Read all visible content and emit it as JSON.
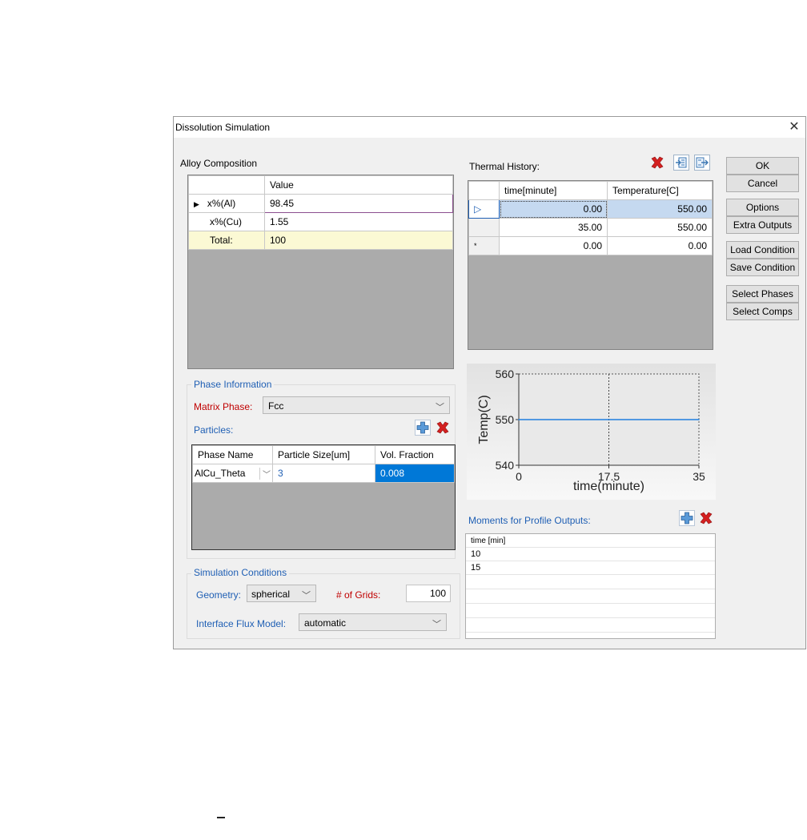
{
  "window": {
    "title": "Dissolution Simulation",
    "close_glyph": "✕"
  },
  "alloy": {
    "label": "Alloy Composition",
    "column_value": "Value",
    "rows": [
      {
        "marker": "▶",
        "name": "x%(Al)",
        "value": "98.45"
      },
      {
        "marker": "",
        "name": "x%(Cu)",
        "value": "1.55"
      },
      {
        "marker": "",
        "name": "Total:",
        "value": "100"
      }
    ]
  },
  "thermal": {
    "label": "Thermal History:",
    "columns": [
      "time[minute]",
      "Temperature[C]"
    ],
    "rows": [
      {
        "marker": "▷",
        "time": "0.00",
        "temp": "550.00"
      },
      {
        "marker": "",
        "time": "35.00",
        "temp": "550.00"
      },
      {
        "marker": "*",
        "time": "0.00",
        "temp": "0.00"
      }
    ],
    "icons": [
      "delete-icon",
      "import-icon",
      "export-icon"
    ]
  },
  "buttons": {
    "ok": "OK",
    "cancel": "Cancel",
    "options": "Options",
    "extra_outputs": "Extra Outputs",
    "load_condition": "Load Condition",
    "save_condition": "Save Condition",
    "select_phases": "Select Phases",
    "select_comps": "Select Comps"
  },
  "phase": {
    "group_label": "Phase Information",
    "matrix_label": "Matrix Phase:",
    "matrix_value": "Fcc",
    "particles_label": "Particles:",
    "columns": [
      "Phase Name",
      "Particle Size[um]",
      "Vol. Fraction"
    ],
    "rows": [
      {
        "name": "AlCu_Theta",
        "size": "3",
        "fraction": "0.008"
      }
    ]
  },
  "simulation": {
    "group_label": "Simulation Conditions",
    "geometry_label": "Geometry:",
    "geometry_value": "spherical",
    "grids_label": "# of Grids:",
    "grids_value": "100",
    "flux_label": "Interface Flux Model:",
    "flux_value": "automatic"
  },
  "chart_data": {
    "type": "line",
    "x": [
      0,
      35
    ],
    "y": [
      550,
      550
    ],
    "xlabel": "time(minute)",
    "ylabel": "Temp(C)",
    "xlim": [
      0,
      35
    ],
    "ylim": [
      540,
      560
    ],
    "xticks": [
      "0",
      "17.5",
      "35"
    ],
    "yticks": [
      "560",
      "550",
      "540"
    ],
    "line_color": "#1f7fe0"
  },
  "moments": {
    "label": "Moments for Profile Outputs:",
    "header": "time [min]",
    "values": [
      "10",
      "15"
    ]
  }
}
